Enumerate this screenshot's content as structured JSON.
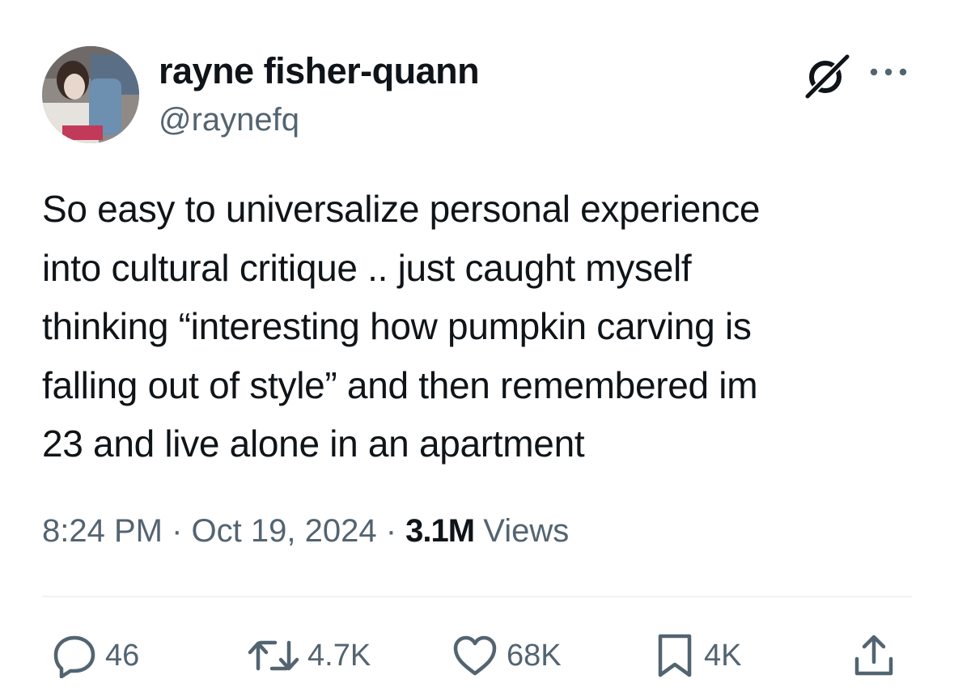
{
  "author": {
    "display_name": "rayne fisher-quann",
    "handle": "@raynefq"
  },
  "tweet": {
    "text_lines": [
      "So easy to universalize personal experience",
      "into cultural critique .. just caught myself",
      "thinking “interesting how pumpkin carving is",
      "falling out of style” and then remembered im",
      "23 and live alone in an apartment"
    ]
  },
  "meta": {
    "time": "8:24 PM",
    "separator": "·",
    "date": "Oct 19, 2024",
    "views_count": "3.1M",
    "views_label": "Views"
  },
  "actions": {
    "replies": "46",
    "reposts": "4.7K",
    "likes": "68K",
    "bookmarks": "4K"
  },
  "icons": {
    "header": [
      "grok-icon",
      "more-icon"
    ],
    "actions": [
      "reply-icon",
      "retweet-icon",
      "heart-icon",
      "bookmark-icon",
      "share-icon"
    ]
  },
  "colors": {
    "text": "#0f1419",
    "secondary": "#536471",
    "divider": "#eff3f4"
  }
}
